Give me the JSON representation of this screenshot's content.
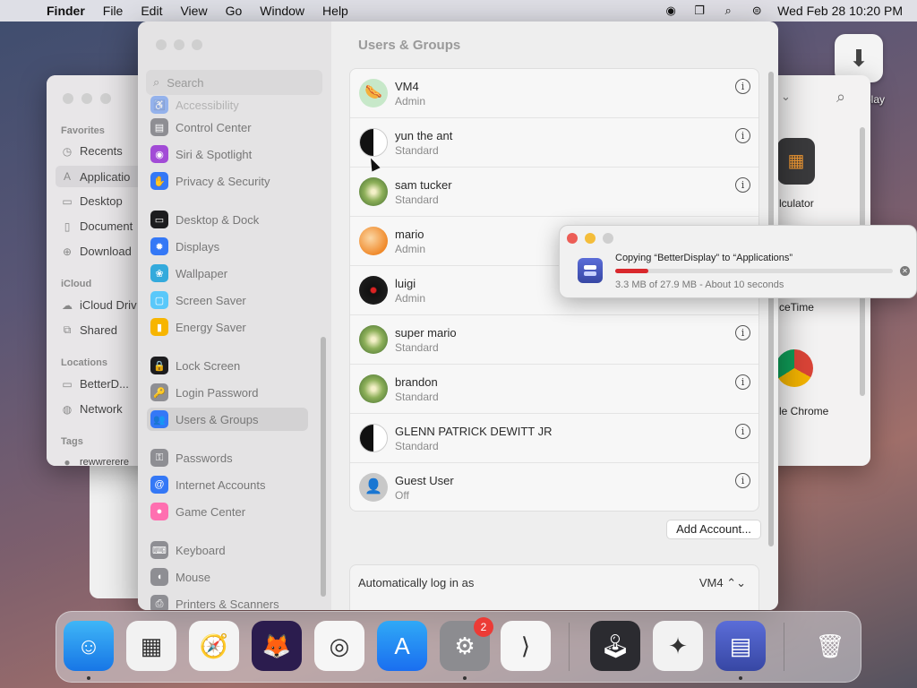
{
  "menubar": {
    "app": "Finder",
    "items": [
      "File",
      "Edit",
      "View",
      "Go",
      "Window",
      "Help"
    ],
    "clock": "Wed Feb 28  10:20 PM"
  },
  "finder": {
    "sections": {
      "favorites": "Favorites",
      "icloud": "iCloud",
      "locations": "Locations",
      "tags": "Tags"
    },
    "items": {
      "recents": "Recents",
      "applications": "Applicatio",
      "desktop": "Desktop",
      "documents": "Document",
      "downloads": "Download",
      "icloud_drive": "iCloud Driv",
      "shared": "Shared",
      "betterdisplay": "BetterD...",
      "network": "Network",
      "tag": "rewwrerere"
    },
    "app_labels": {
      "calculator": "lculator",
      "facetime": "ceTime",
      "chrome": "le Chrome"
    }
  },
  "desktop": {
    "icon_label": "play"
  },
  "settings": {
    "search_placeholder": "Search",
    "sidebar": [
      {
        "label": "Accessibility",
        "color": "#3478f6",
        "glyph": "♿"
      },
      {
        "label": "Control Center",
        "color": "#8e8e93",
        "glyph": "▤"
      },
      {
        "label": "Siri & Spotlight",
        "color": "#a24bd6",
        "glyph": "◉"
      },
      {
        "label": "Privacy & Security",
        "color": "#3478f6",
        "glyph": "✋"
      },
      {
        "label": "Desktop & Dock",
        "color": "#1c1c1e",
        "glyph": "▭"
      },
      {
        "label": "Displays",
        "color": "#3478f6",
        "glyph": "✹"
      },
      {
        "label": "Wallpaper",
        "color": "#34aadc",
        "glyph": "❀"
      },
      {
        "label": "Screen Saver",
        "color": "#5ac8fa",
        "glyph": "▢"
      },
      {
        "label": "Energy Saver",
        "color": "#f7b500",
        "glyph": "▮"
      },
      {
        "label": "Lock Screen",
        "color": "#1c1c1e",
        "glyph": "🔒"
      },
      {
        "label": "Login Password",
        "color": "#8e8e93",
        "glyph": "🔑"
      },
      {
        "label": "Users & Groups",
        "color": "#3478f6",
        "glyph": "👥"
      },
      {
        "label": "Passwords",
        "color": "#8e8e93",
        "glyph": "⚿"
      },
      {
        "label": "Internet Accounts",
        "color": "#3478f6",
        "glyph": "@"
      },
      {
        "label": "Game Center",
        "color": "#ff6fb0",
        "glyph": "●"
      },
      {
        "label": "Keyboard",
        "color": "#8e8e93",
        "glyph": "⌨"
      },
      {
        "label": "Mouse",
        "color": "#8e8e93",
        "glyph": "◖"
      },
      {
        "label": "Printers & Scanners",
        "color": "#8e8e93",
        "glyph": "⎙"
      }
    ],
    "title": "Users & Groups",
    "users": [
      {
        "name": "VM4",
        "role": "Admin",
        "avatar": "av-hotdog",
        "glyph": "🌭"
      },
      {
        "name": "yun the ant",
        "role": "Standard",
        "avatar": "av-yinyang",
        "glyph": ""
      },
      {
        "name": "sam tucker",
        "role": "Standard",
        "avatar": "av-dandelion",
        "glyph": ""
      },
      {
        "name": "mario",
        "role": "Admin",
        "avatar": "av-orange",
        "glyph": ""
      },
      {
        "name": "luigi",
        "role": "Admin",
        "avatar": "av-vinyl",
        "glyph": ""
      },
      {
        "name": "super mario",
        "role": "Standard",
        "avatar": "av-dandelion",
        "glyph": ""
      },
      {
        "name": "brandon",
        "role": "Standard",
        "avatar": "av-dandelion",
        "glyph": ""
      },
      {
        "name": "GLENN PATRICK DEWITT JR",
        "role": "Standard",
        "avatar": "av-yinyang",
        "glyph": ""
      },
      {
        "name": "Guest User",
        "role": "Off",
        "avatar": "av-guest",
        "glyph": "👤"
      }
    ],
    "add_account": "Add Account...",
    "autologin_label": "Automatically log in as",
    "autologin_value": "VM4 ⌃⌄"
  },
  "copy": {
    "message": "Copying “BetterDisplay” to “Applications”",
    "progress": 0.12,
    "status": "3.3 MB of 27.9 MB - About 10 seconds"
  },
  "dock": {
    "apps": [
      {
        "name": "finder",
        "bg": "linear-gradient(#3fb6f7,#1776e6)",
        "glyph": "☺",
        "running": true
      },
      {
        "name": "launchpad",
        "bg": "#f2f2f2",
        "glyph": "▦",
        "running": false
      },
      {
        "name": "safari",
        "bg": "#f4f4f4",
        "glyph": "🧭",
        "running": false
      },
      {
        "name": "firefox",
        "bg": "#2b1c4e",
        "glyph": "🦊",
        "running": false
      },
      {
        "name": "chrome",
        "bg": "#f6f6f6",
        "glyph": "◎",
        "running": false
      },
      {
        "name": "app-store",
        "bg": "linear-gradient(#30a9f6,#1a6ef0)",
        "glyph": "A",
        "running": false
      },
      {
        "name": "system-settings",
        "bg": "#8c8c90",
        "glyph": "⚙",
        "running": true,
        "badge": "2"
      },
      {
        "name": "vscode",
        "bg": "#f6f6f6",
        "glyph": "⟩",
        "running": false
      },
      {
        "name": "joystick-app",
        "bg": "#2b2b30",
        "glyph": "🕹",
        "running": false
      },
      {
        "name": "mario-app",
        "bg": "#f2f2f2",
        "glyph": "✦",
        "running": false
      },
      {
        "name": "betterdisplay",
        "bg": "linear-gradient(#5b6dd8,#3747a4)",
        "glyph": "▤",
        "running": true
      },
      {
        "name": "trash",
        "bg": "transparent",
        "glyph": "🗑",
        "running": false
      }
    ]
  }
}
